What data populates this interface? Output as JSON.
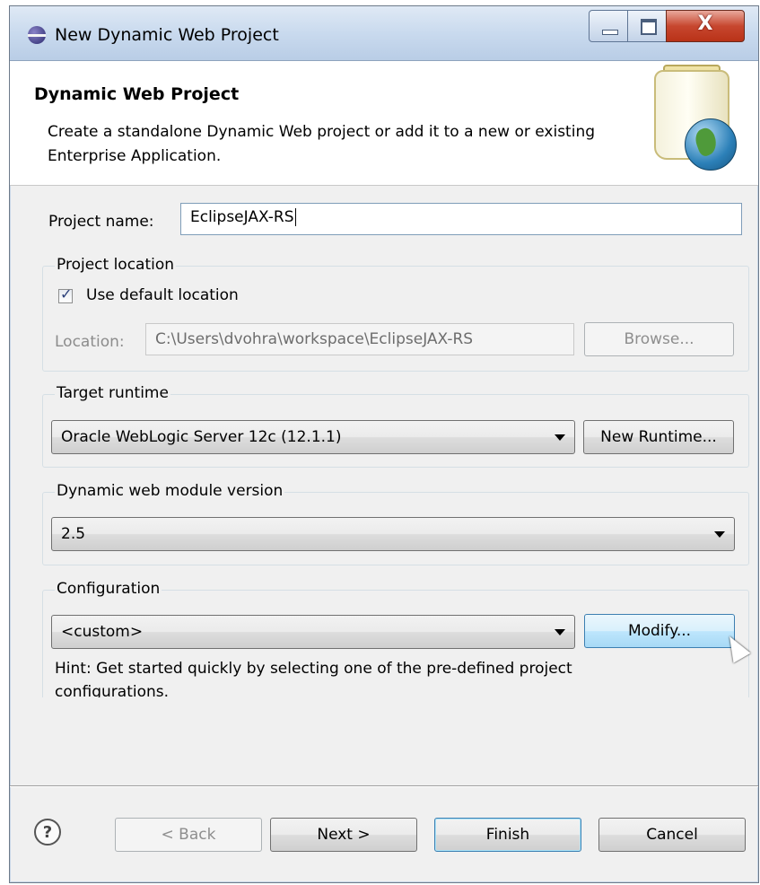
{
  "window": {
    "title": "New Dynamic Web Project",
    "close_glyph": "X"
  },
  "banner": {
    "title": "Dynamic Web Project",
    "description": "Create a standalone Dynamic Web project or add it to a new or existing Enterprise Application."
  },
  "project_name": {
    "label": "Project name:",
    "value": "EclipseJAX-RS"
  },
  "project_location": {
    "title": "Project location",
    "use_default_label": "Use default location",
    "use_default_checked": true,
    "location_label": "Location:",
    "location_value": "C:\\Users\\dvohra\\workspace\\EclipseJAX-RS",
    "browse_label": "Browse..."
  },
  "target_runtime": {
    "title": "Target runtime",
    "selected": "Oracle WebLogic Server 12c (12.1.1)",
    "new_runtime_label": "New Runtime..."
  },
  "module_version": {
    "title": "Dynamic web module version",
    "selected": "2.5"
  },
  "configuration": {
    "title": "Configuration",
    "selected": "<custom>",
    "modify_label": "Modify...",
    "hint": "Hint: Get started quickly by selecting one of the pre-defined project configurations."
  },
  "footer": {
    "help_glyph": "?",
    "back_label": "< Back",
    "next_label": "Next >",
    "finish_label": "Finish",
    "cancel_label": "Cancel"
  },
  "icons": {
    "window": "eclipse-icon",
    "banner": "jar-globe-icon",
    "checkmark": "✓"
  }
}
